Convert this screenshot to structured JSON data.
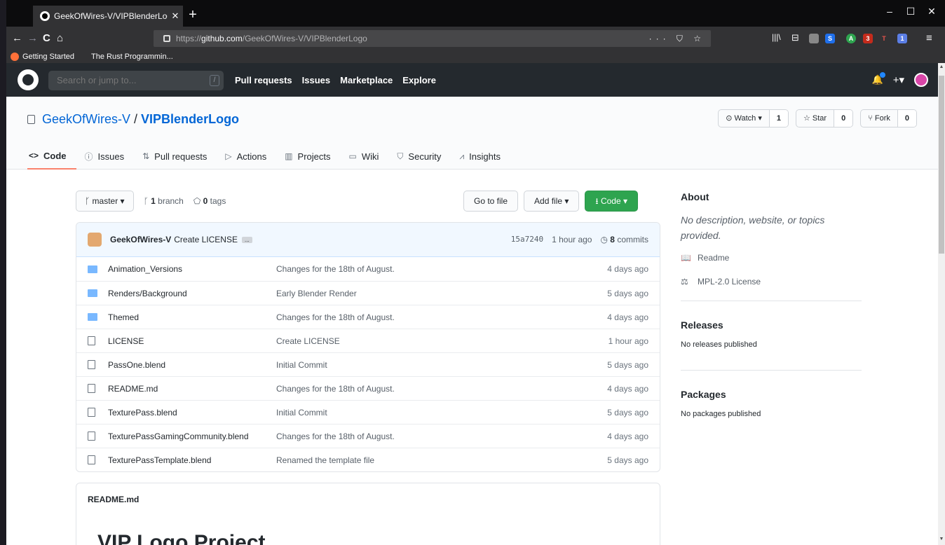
{
  "browser": {
    "tab_title": "GeekOfWires-V/VIPBlenderLogo",
    "tab_close": "✕",
    "new_tab": "+",
    "url_prefix": "https://",
    "url_domain": "github.com",
    "url_path": "/GeekOfWires-V/VIPBlenderLogo",
    "url_actions": "··· ⛉ ☆",
    "bookmarks": [
      "Getting Started",
      "The Rust Programmin..."
    ],
    "window_controls": [
      "–",
      "☐",
      "✕"
    ],
    "back": "←",
    "forward": "→",
    "reload": "C",
    "home": "⌂",
    "toolbar_icons": [
      "|||\\",
      "⊟"
    ],
    "extensions": [
      {
        "label": "",
        "color": "#888888"
      },
      {
        "label": "S",
        "color": "#1f6feb"
      },
      {
        "label": "A",
        "color": "#2ea44f"
      },
      {
        "label": "3",
        "color": "#c42b1c"
      },
      {
        "label": "T",
        "color": "#e8554e"
      },
      {
        "label": "1",
        "color": "#5b7ee5"
      }
    ],
    "menu": "≡"
  },
  "github_header": {
    "search_placeholder": "Search or jump to...",
    "search_key": "/",
    "nav": [
      "Pull requests",
      "Issues",
      "Marketplace",
      "Explore"
    ],
    "notif": "🔔",
    "plus": "+▾"
  },
  "repo": {
    "owner": "GeekOfWires-V",
    "separator": "/",
    "name": "VIPBlenderLogo",
    "watch_label": "⊙ Watch ▾",
    "watch_count": "1",
    "star_label": "☆ Star",
    "star_count": "0",
    "fork_label": "⑂ Fork",
    "fork_count": "0",
    "tabs": [
      {
        "icon": "<>",
        "label": "Code"
      },
      {
        "icon": "ⓘ",
        "label": "Issues"
      },
      {
        "icon": "⇅",
        "label": "Pull requests"
      },
      {
        "icon": "▷",
        "label": "Actions"
      },
      {
        "icon": "▥",
        "label": "Projects"
      },
      {
        "icon": "▭",
        "label": "Wiki"
      },
      {
        "icon": "⛉",
        "label": "Security"
      },
      {
        "icon": "⩘",
        "label": "Insights"
      }
    ]
  },
  "toolbar": {
    "branch": "ᚴ master ▾",
    "branch_count": "1",
    "branch_word": "branch",
    "tag_count": "0",
    "tag_word": "tags",
    "go_to_file": "Go to file",
    "add_file": "Add file ▾",
    "code_btn": "⭳  Code ▾"
  },
  "commit": {
    "author": "GeekOfWires-V",
    "message": "Create LICENSE",
    "dots": "...",
    "sha": "15a7240",
    "time": "1 hour ago",
    "count": "8",
    "count_word": "commits"
  },
  "files": [
    {
      "type": "folder",
      "name": "Animation_Versions",
      "msg": "Changes for the 18th of August.",
      "age": "4 days ago"
    },
    {
      "type": "folder",
      "name": "Renders/Background",
      "msg": "Early Blender Render",
      "age": "5 days ago"
    },
    {
      "type": "folder",
      "name": "Themed",
      "msg": "Changes for the 18th of August.",
      "age": "4 days ago"
    },
    {
      "type": "file",
      "name": "LICENSE",
      "msg": "Create LICENSE",
      "age": "1 hour ago"
    },
    {
      "type": "file",
      "name": "PassOne.blend",
      "msg": "Initial Commit",
      "age": "5 days ago"
    },
    {
      "type": "file",
      "name": "README.md",
      "msg": "Changes for the 18th of August.",
      "age": "4 days ago"
    },
    {
      "type": "file",
      "name": "TexturePass.blend",
      "msg": "Initial Commit",
      "age": "5 days ago"
    },
    {
      "type": "file",
      "name": "TexturePassGamingCommunity.blend",
      "msg": "Changes for the 18th of August.",
      "age": "4 days ago"
    },
    {
      "type": "file",
      "name": "TexturePassTemplate.blend",
      "msg": "Renamed the template file",
      "age": "5 days ago"
    }
  ],
  "readme": {
    "filename": "README.md",
    "heading": "VIP Logo Project"
  },
  "sidebar": {
    "about_title": "About",
    "about_desc": "No description, website, or topics provided.",
    "readme_icon": "📖",
    "readme": "Readme",
    "license_icon": "⚖",
    "license": "MPL-2.0 License",
    "releases_title": "Releases",
    "releases_text": "No releases published",
    "packages_title": "Packages",
    "packages_text": "No packages published"
  },
  "scrollbar": {
    "up": "▲",
    "down": "▼"
  }
}
